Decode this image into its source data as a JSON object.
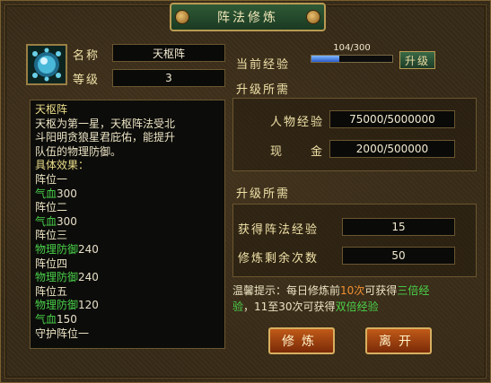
{
  "window": {
    "title": "阵法修炼"
  },
  "formation": {
    "name_label": "名称",
    "name_value": "天枢阵",
    "level_label": "等级",
    "level_value": "3",
    "icon": "blue-orb-icon"
  },
  "description": {
    "title": "天枢阵",
    "intro": [
      "天枢为第一星，天枢阵法受北",
      "斗阳明贪狼星君庇佑，能提升",
      "队伍的物理防御。"
    ],
    "effects_header": "具体效果：",
    "positions": [
      {
        "name": "阵位一",
        "stat": "气血",
        "value": "300"
      },
      {
        "name": "阵位二",
        "stat": "气血",
        "value": "300"
      },
      {
        "name": "阵位三",
        "stat": "物理防御",
        "value": "240"
      },
      {
        "name": "阵位四",
        "stat": "物理防御",
        "value": "240"
      },
      {
        "name": "阵位五",
        "stat": "物理防御",
        "value": "120"
      }
    ],
    "extra_stat": {
      "stat": "气血",
      "value": "150"
    },
    "last_line": "守护阵位一"
  },
  "experience": {
    "label": "当前经验",
    "text": "104/300",
    "current": 104,
    "max": 300,
    "upgrade_button": "升级"
  },
  "upgrade_req": {
    "header": "升级所需",
    "char_exp_label": "人物经验",
    "char_exp_value": "75000/5000000",
    "cash_label": "现　　金",
    "cash_value": "2000/500000"
  },
  "train_req": {
    "header": "升级所需",
    "gain_label": "获得阵法经验",
    "gain_value": "15",
    "remain_label": "修炼剩余次数",
    "remain_value": "50"
  },
  "tip": {
    "p1": "温馨提示：每日修炼前",
    "p2": "10次",
    "p3": "可获得",
    "p4": "三倍经",
    "p5": "验",
    "p6": "，11至30次可获得",
    "p7": "双倍经验"
  },
  "buttons": {
    "train": "修炼",
    "leave": "离开"
  },
  "colors": {
    "green": "#4ad24a",
    "orange": "#f09030",
    "exp_bar": "#2a5cc8"
  }
}
